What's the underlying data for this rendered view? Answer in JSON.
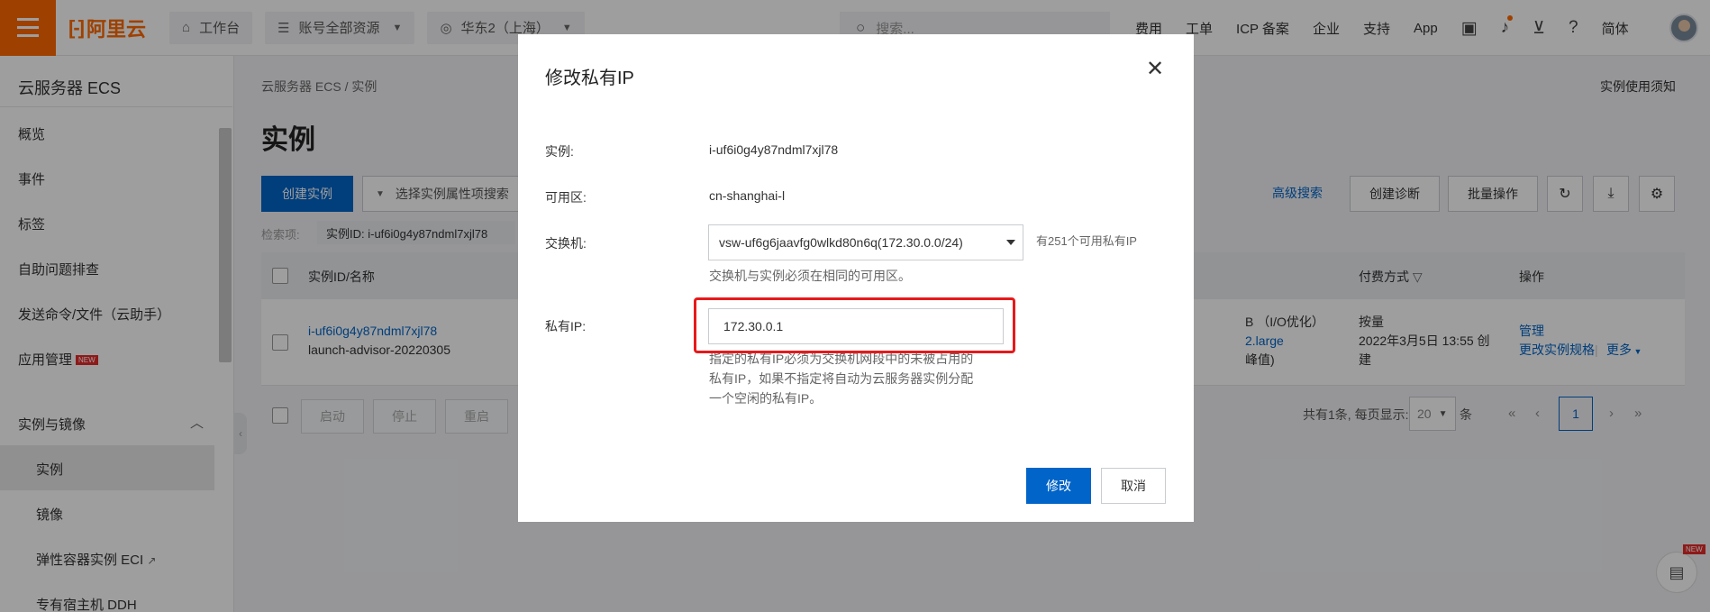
{
  "topbar": {
    "brand": "阿里云",
    "workbench": "工作台",
    "resources": "账号全部资源",
    "region": "华东2（上海）",
    "search_placeholder": "搜索...",
    "links": [
      "费用",
      "工单",
      "ICP 备案",
      "企业",
      "支持",
      "App"
    ],
    "lang": "简体"
  },
  "sidebar": {
    "title": "云服务器 ECS",
    "items": [
      "概览",
      "事件",
      "标签",
      "自助问题排查",
      "发送命令/文件（云助手）",
      "应用管理"
    ],
    "new_badge": "NEW",
    "group": "实例与镜像",
    "sub_items": [
      "实例",
      "镜像",
      "弹性容器实例 ECI",
      "专有宿主机 DDH"
    ]
  },
  "main": {
    "breadcrumb": "云服务器 ECS / 实例",
    "notice": "实例使用须知",
    "title": "实例",
    "create_btn": "创建实例",
    "filter_placeholder": "选择实例属性项搜索",
    "advanced_search": "高级搜索",
    "diagnose_btn": "创建诊断",
    "batch_btn": "批量操作",
    "criteria_label": "检索项:",
    "criteria_tag": "实例ID: i-uf6i0g4y87ndml7xjl78",
    "table": {
      "headers": [
        "实例ID/名称",
        "付费方式",
        "操作"
      ],
      "row": {
        "id": "i-uf6i0g4y87ndml7xjl78",
        "name": "launch-advisor-20220305",
        "spec_line1": "B （I/O优化）",
        "spec_line2": "2.large",
        "spec_line3": "峰值)",
        "pay_type": "按量",
        "pay_time": "2022年3月5日 13:55 创",
        "pay_time2": "建",
        "op_manage": "管理",
        "op_change": "更改实例规格",
        "op_more": "更多"
      }
    },
    "footer_buttons": [
      "启动",
      "停止",
      "重启"
    ],
    "pager": {
      "total_text": "共有1条, 每页显示:",
      "page_size": "20",
      "unit": "条",
      "current": "1"
    }
  },
  "modal": {
    "title": "修改私有IP",
    "instance_label": "实例:",
    "instance_value": "i-uf6i0g4y87ndml7xjl78",
    "zone_label": "可用区:",
    "zone_value": "cn-shanghai-l",
    "vswitch_label": "交换机:",
    "vswitch_value": "vsw-uf6g6jaavfg0wlkd80n6q(172.30.0.0/24)",
    "available_ip": "有251个可用私有IP",
    "vswitch_hint": "交换机与实例必须在相同的可用区。",
    "ip_label": "私有IP:",
    "ip_value": "172.30.0.1",
    "ip_hint_1": "指定的私有IP必须为交换机网段中的未被占用的",
    "ip_hint_2": "私有IP，如果不指定将自动为云服务器实例分配",
    "ip_hint_3": "一个空闲的私有IP。",
    "ok": "修改",
    "cancel": "取消"
  },
  "colors": {
    "brand_orange": "#ff6a00",
    "primary_blue": "#0064c8",
    "highlight_red": "#e8191b"
  },
  "icons": [
    "menu-icon",
    "home-icon",
    "resource-icon",
    "location-icon",
    "search-icon",
    "terminal-icon",
    "bell-icon",
    "cart-icon",
    "help-icon",
    "refresh-icon",
    "download-icon",
    "settings-icon",
    "close-icon",
    "filter-icon"
  ]
}
